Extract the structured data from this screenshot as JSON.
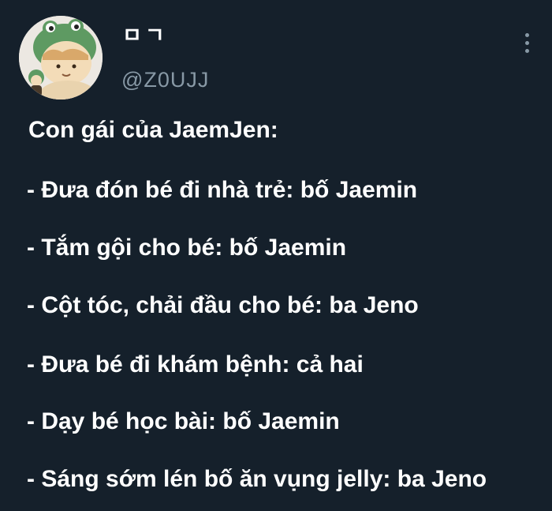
{
  "tweet": {
    "author": {
      "display_name": "ㅁㄱ",
      "handle": "@Z0UJJ"
    },
    "text": {
      "intro": "Con gái của JaemJen:",
      "items": [
        "- Đưa đón bé đi nhà trẻ: bố Jaemin",
        "- Tắm gội cho bé: bố Jaemin",
        "- Cột tóc, chải đầu cho bé: ba Jeno",
        "- Đưa bé đi khám bệnh: cả hai",
        "- Dạy bé học bài: bố Jaemin",
        "- Sáng sớm lén bố ăn vụng jelly: ba Jeno"
      ]
    }
  },
  "icons": {
    "more": "more-options-icon",
    "avatar": "avatar-illustration"
  },
  "colors": {
    "background": "#15202b",
    "text": "#ffffff",
    "secondary_text": "#8899a6"
  }
}
